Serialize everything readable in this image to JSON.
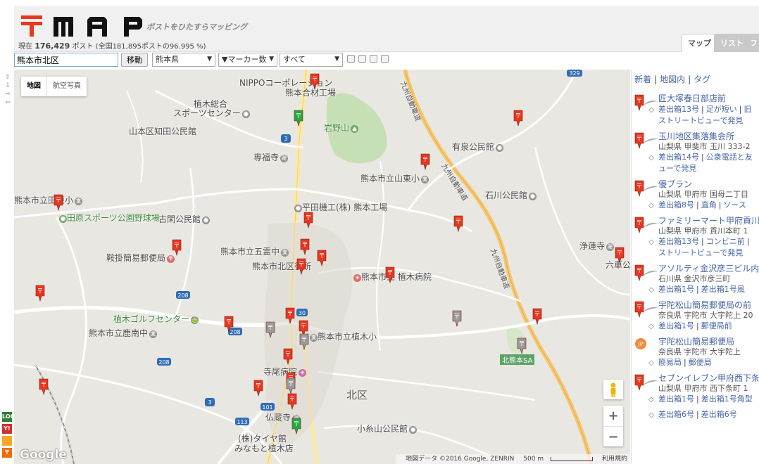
{
  "header": {
    "tagline": "ポストをひたすらマッピング",
    "count_prefix": "現在",
    "count_value": "176,429",
    "count_unit": "ポスト",
    "count_total": "(全国181,895ポストの96.995 %)",
    "tabs": [
      {
        "label": "マップ",
        "active": true
      },
      {
        "label": "リスト",
        "active": false
      },
      {
        "label": "フ",
        "active": false
      }
    ]
  },
  "toolbar": {
    "search_value": "熊本市北区",
    "move_label": "移動",
    "prefecture": "熊本県",
    "marker_count": "▼マーカー数",
    "filter": "すべて"
  },
  "side_arrows": [
    "⇧",
    "⇩",
    "⇨",
    "⇦"
  ],
  "side_icons": [
    {
      "label": "LOC",
      "color": "#2e7d32"
    },
    {
      "label": "Y!",
      "color": "#d32f2f"
    },
    {
      "label": "",
      "color": "#f9a825"
    },
    {
      "label": "〒",
      "color": "#ef6c00"
    }
  ],
  "map": {
    "type_buttons": [
      "地図",
      "航空写真"
    ],
    "zoom_in": "+",
    "zoom_out": "−",
    "google": "Google",
    "attribution": "地図データ ©2016 Google, ZENRIN",
    "scale": "500 m",
    "terms": "利用規約",
    "labels": [
      {
        "text": "NIPPOコーポレーション",
        "kind": "plain"
      },
      {
        "text": "熊本合材工場",
        "kind": "plain"
      },
      {
        "text": "植木総合",
        "kind": "plain"
      },
      {
        "text": "スポーツセンター",
        "kind": "plain"
      },
      {
        "text": "山本区知田公民館",
        "kind": "plain"
      },
      {
        "text": "岩野山",
        "kind": "green"
      },
      {
        "text": "専福寺",
        "kind": "plain"
      },
      {
        "text": "有泉公民館",
        "kind": "plain"
      },
      {
        "text": "熊本市立山東小",
        "kind": "plain"
      },
      {
        "text": "石川公民館",
        "kind": "plain"
      },
      {
        "text": "熊本市立田原小",
        "kind": "plain"
      },
      {
        "text": "田原スポーツ公園野球場",
        "kind": "green"
      },
      {
        "text": "平田機工(株) 熊本工場",
        "kind": "plain"
      },
      {
        "text": "古閑公民館",
        "kind": "plain"
      },
      {
        "text": "熊本市立五霊中",
        "kind": "plain"
      },
      {
        "text": "鞍掛簡易郵便局",
        "kind": "plain"
      },
      {
        "text": "熊本市北区役所",
        "kind": "plain"
      },
      {
        "text": "熊本市立 植木病院",
        "kind": "plain"
      },
      {
        "text": "浄蓮寺",
        "kind": "plain"
      },
      {
        "text": "六車公",
        "kind": "plain"
      },
      {
        "text": "植木ゴルフセンター",
        "kind": "green"
      },
      {
        "text": "熊本市立鹿南中",
        "kind": "plain"
      },
      {
        "text": "熊本市立植木小",
        "kind": "plain"
      },
      {
        "text": "北熊本SA",
        "kind": "sa"
      },
      {
        "text": "寺尾病院",
        "kind": "plain"
      },
      {
        "text": "北区",
        "kind": "region"
      },
      {
        "text": "仏蔵寺",
        "kind": "plain"
      },
      {
        "text": "小糸山公民館",
        "kind": "plain"
      },
      {
        "text": "(株)タイヤ館",
        "kind": "plain"
      },
      {
        "text": "みなもと植木店",
        "kind": "plain"
      },
      {
        "text": "九州自動車道",
        "kind": "road"
      },
      {
        "text": "九州自動車道",
        "kind": "road"
      },
      {
        "text": "九州自動車道",
        "kind": "road"
      }
    ],
    "route_shields": [
      "3",
      "329",
      "208",
      "208",
      "208",
      "30",
      "3",
      "101",
      "113"
    ]
  },
  "sidebar": {
    "nav": [
      "新着",
      "地図内",
      "タグ"
    ],
    "entries": [
      {
        "title": "匠大塚春日部店前",
        "addr": "",
        "tags": [
          "差出箱13号",
          "足が短い",
          "旧"
        ],
        "icon": "pin",
        "extra": "ストリートビューで発見"
      },
      {
        "title": "玉川地区集落集会所",
        "addr": "山梨県 甲斐市 玉川 333-2",
        "tags": [
          "差出箱14号",
          "公衆電話と友"
        ],
        "icon": "pin",
        "extra": "ューで発見"
      },
      {
        "title": "優ブラン",
        "addr": "山梨県 甲府市 国母二丁目",
        "tags": [
          "差出箱8号",
          "直角",
          "ソース"
        ],
        "icon": "pin",
        "extra": ""
      },
      {
        "title": "ファミリーマート甲府貢川店",
        "addr": "山梨県 甲府市 貢川本町 1",
        "tags": [
          "差出箱13号",
          "コンビニ前",
          ""
        ],
        "icon": "pin",
        "extra": "ストリートビューで発見"
      },
      {
        "title": "アソルティ金沢彦三ビル内",
        "addr": "石川県 金沢市彦三町",
        "tags": [
          "差出箱1号",
          "差出箱1号風"
        ],
        "icon": "pin",
        "extra": ""
      },
      {
        "title": "宇陀松山簡易郵便局の前",
        "addr": "奈良県 宇陀市 大宇陀上 20",
        "tags": [
          "差出箱1号",
          "郵便局前"
        ],
        "icon": "pin",
        "extra": ""
      },
      {
        "title": "宇陀松山簡易郵便局",
        "addr": "奈良県 宇陀市 大宇陀上",
        "tags": [
          "簡易局",
          "郵便局"
        ],
        "icon": "jp",
        "extra": ""
      },
      {
        "title": "セブンイレブン甲府西下条",
        "addr": "山梨県 甲府市 西下条町 1",
        "tags": [
          "差出箱1号",
          "差出箱1号角型"
        ],
        "icon": "pin",
        "extra": ""
      },
      {
        "title": "",
        "addr": "",
        "tags": [
          "差出箱6号",
          "差出箱6号"
        ],
        "icon": "none",
        "extra": ""
      }
    ]
  },
  "colors": {
    "accent": "#e8371f",
    "link": "#4866a8",
    "pin_red": "#e8371f",
    "pin_green": "#27a844",
    "pin_gray": "#9a9a9a"
  }
}
